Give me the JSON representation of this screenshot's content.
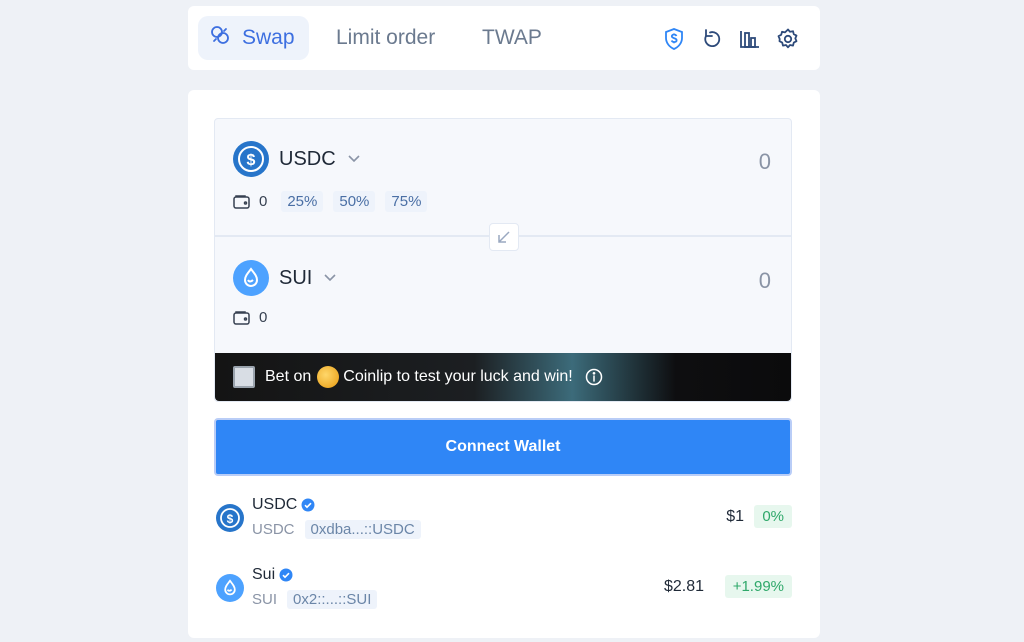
{
  "tabs": {
    "swap": "Swap",
    "limit": "Limit order",
    "twap": "TWAP",
    "tools": [
      "shield-dollar-icon",
      "refresh-icon",
      "chart-icon",
      "gear-icon"
    ]
  },
  "swap": {
    "from": {
      "token": "USDC",
      "amount": "0",
      "balance": "0",
      "percents": [
        "25%",
        "50%",
        "75%"
      ]
    },
    "to": {
      "token": "SUI",
      "amount": "0",
      "balance": "0"
    }
  },
  "promo": {
    "prefix": "Bet on",
    "text": "Coinlip to test your luck and win!"
  },
  "connect_label": "Connect Wallet",
  "tokens": [
    {
      "name": "USDC",
      "symbol": "USDC",
      "address": "0xdba...::USDC",
      "price": "$1",
      "change": "0%"
    },
    {
      "name": "Sui",
      "symbol": "SUI",
      "address": "0x2::...::SUI",
      "price": "$2.81",
      "change": "+1.99%"
    }
  ],
  "colors": {
    "accent": "#2f86f6",
    "usdc": "#2775ca",
    "sui": "#4da2ff",
    "positive": "#2fa86a"
  }
}
